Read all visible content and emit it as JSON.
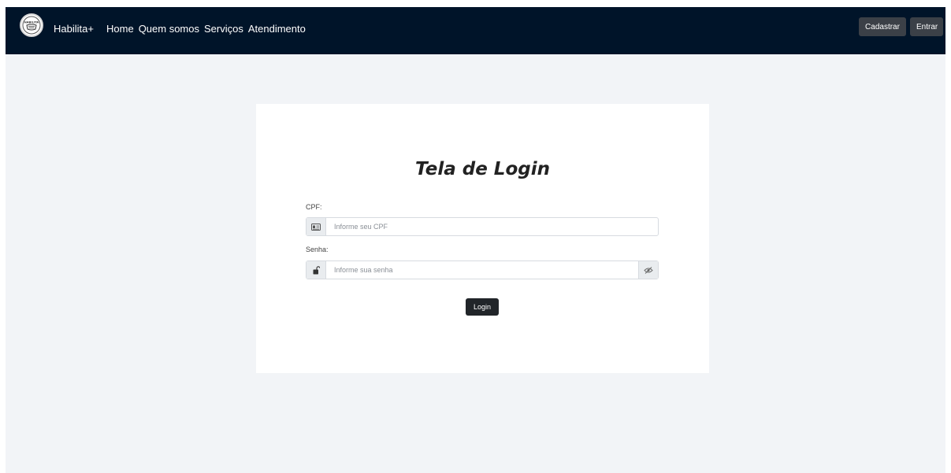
{
  "navbar": {
    "brand_name": "Habilita+",
    "logo_text": "HABILITA",
    "links": [
      "Home",
      "Quem somos",
      "Serviços",
      "Atendimento"
    ],
    "signup_label": "Cadastrar",
    "login_label": "Entrar"
  },
  "login": {
    "title": "Tela de Login",
    "cpf_label": "CPF:",
    "cpf_placeholder": "Informe seu CPF",
    "password_label": "Senha:",
    "password_placeholder": "Informe sua senha",
    "submit_label": "Login"
  },
  "icons": {
    "cpf": "id-card-icon",
    "password": "lock-icon",
    "toggle": "eye-slash-icon"
  },
  "colors": {
    "navbar_bg": "#001429",
    "page_bg": "#f2f4f7",
    "button_dark": "#212529",
    "nav_button": "#3b4047"
  }
}
